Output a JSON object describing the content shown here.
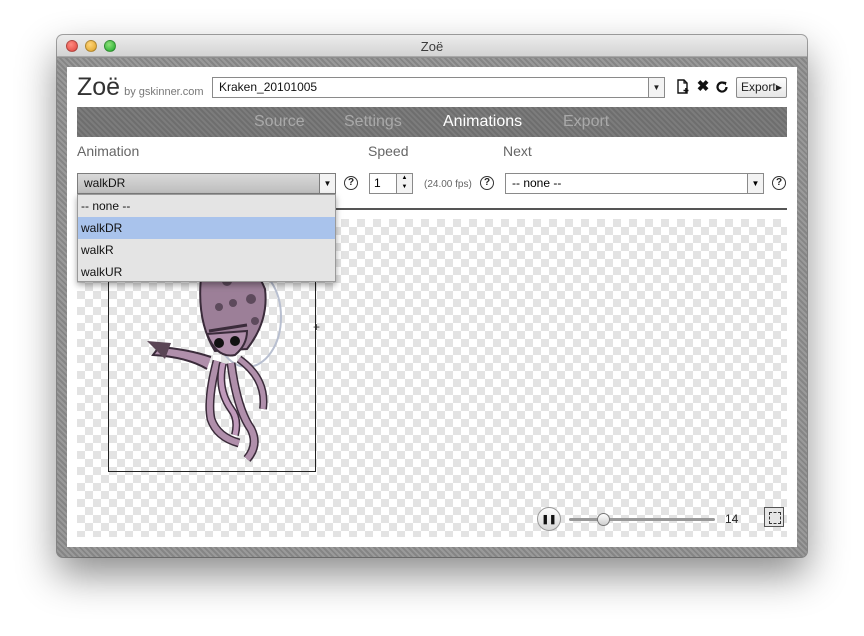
{
  "window": {
    "title": "Zoë"
  },
  "header": {
    "app_name": "Zoë",
    "by_line": "by gskinner.com",
    "file_selected": "Kraken_20101005",
    "export_label": "Export"
  },
  "nav": {
    "tabs": [
      {
        "label": "Source"
      },
      {
        "label": "Settings"
      },
      {
        "label": "Animations"
      },
      {
        "label": "Export"
      }
    ],
    "active": "Animations"
  },
  "animation_panel": {
    "animation_label": "Animation",
    "speed_label": "Speed",
    "next_label": "Next",
    "animation_selected": "walkDR",
    "speed_value": "1",
    "fps_text": "(24.00 fps)",
    "next_selected": "-- none --",
    "help_glyph": "?",
    "dropdown_options": [
      {
        "label": "-- none --"
      },
      {
        "label": "walkDR"
      },
      {
        "label": "walkR"
      },
      {
        "label": "walkUR"
      }
    ],
    "dropdown_highlighted": "walkDR"
  },
  "playback": {
    "frame_number": "14",
    "slider_position_fraction": 0.23,
    "state": "playing"
  },
  "icons": {
    "new_file": "new-file-icon",
    "close": "close-icon",
    "reload": "reload-icon",
    "pause": "pause-icon",
    "fit": "fit-to-stage-icon"
  },
  "colors": {
    "dropdown_highlight": "#a9c3ec",
    "nav_active": "#ffffff",
    "nav_inactive": "#a9a9a9"
  }
}
